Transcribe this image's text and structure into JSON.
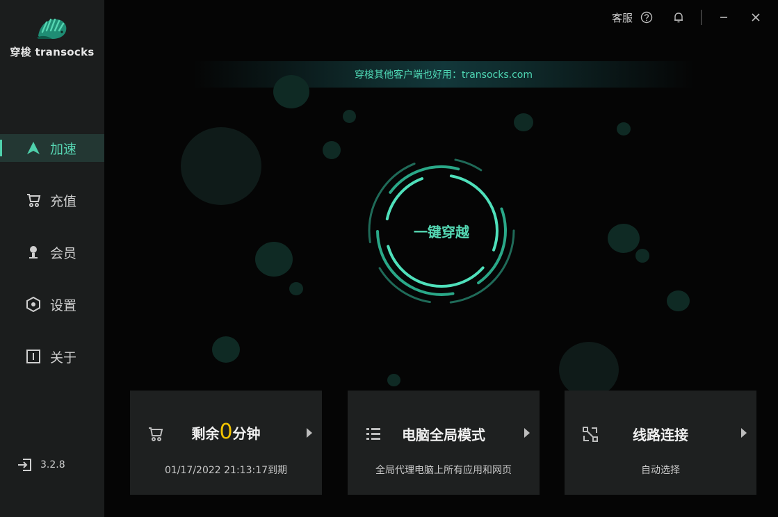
{
  "app": {
    "logo_text": "穿梭 transocks",
    "version": "3.2.8"
  },
  "titlebar": {
    "service_label": "客服"
  },
  "nav": [
    {
      "label": "加速",
      "icon": "arrow-up-icon",
      "active": true
    },
    {
      "label": "充值",
      "icon": "cart-icon",
      "active": false
    },
    {
      "label": "会员",
      "icon": "member-icon",
      "active": false
    },
    {
      "label": "设置",
      "icon": "hexagon-icon",
      "active": false
    },
    {
      "label": "关于",
      "icon": "info-icon",
      "active": false
    }
  ],
  "banner": {
    "text": "穿梭其他客户端也好用：transocks.com"
  },
  "center": {
    "button_label": "一键穿越"
  },
  "cards": {
    "time": {
      "prefix": "剩余",
      "number": "0",
      "suffix": "分钟",
      "expiry": "01/17/2022 21:13:17到期"
    },
    "mode": {
      "title": "电脑全局模式",
      "subtitle": "全局代理电脑上所有应用和网页"
    },
    "route": {
      "title": "线路连接",
      "subtitle": "自动选择"
    }
  },
  "colors": {
    "accent": "#4fd1ac",
    "highlight": "#f2c300",
    "sidebar_bg": "#1b1d1d",
    "card_bg": "#1e2020"
  }
}
